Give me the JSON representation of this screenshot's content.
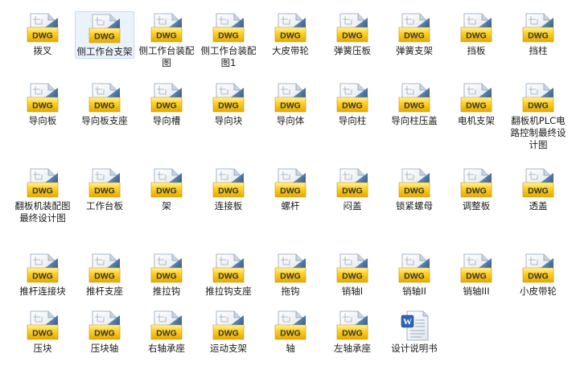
{
  "files": [
    {
      "label": "拨叉",
      "type": "dwg",
      "icon": "dwg-file-icon"
    },
    {
      "label": "侧工作台支架",
      "type": "dwg",
      "icon": "dwg-file-icon",
      "selected": true
    },
    {
      "label": "侧工作台装配图",
      "type": "dwg",
      "icon": "dwg-file-icon"
    },
    {
      "label": "侧工作台装配图1",
      "type": "dwg",
      "icon": "dwg-file-icon"
    },
    {
      "label": "大皮带轮",
      "type": "dwg",
      "icon": "dwg-file-icon"
    },
    {
      "label": "弹簧压板",
      "type": "dwg",
      "icon": "dwg-file-icon"
    },
    {
      "label": "弹簧支架",
      "type": "dwg",
      "icon": "dwg-file-icon"
    },
    {
      "label": "挡板",
      "type": "dwg",
      "icon": "dwg-file-icon"
    },
    {
      "label": "挡柱",
      "type": "dwg",
      "icon": "dwg-file-icon"
    },
    {
      "label": "导向板",
      "type": "dwg",
      "icon": "dwg-file-icon"
    },
    {
      "label": "导向板支座",
      "type": "dwg",
      "icon": "dwg-file-icon"
    },
    {
      "label": "导向槽",
      "type": "dwg",
      "icon": "dwg-file-icon"
    },
    {
      "label": "导向块",
      "type": "dwg",
      "icon": "dwg-file-icon"
    },
    {
      "label": "导向体",
      "type": "dwg",
      "icon": "dwg-file-icon"
    },
    {
      "label": "导向柱",
      "type": "dwg",
      "icon": "dwg-file-icon"
    },
    {
      "label": "导向柱压盖",
      "type": "dwg",
      "icon": "dwg-file-icon"
    },
    {
      "label": "电机支架",
      "type": "dwg",
      "icon": "dwg-file-icon"
    },
    {
      "label": "翻板机PLC电路控制最终设计图",
      "type": "dwg",
      "icon": "dwg-file-icon"
    },
    {
      "label": "翻板机装配图最终设计图",
      "type": "dwg",
      "icon": "dwg-file-icon"
    },
    {
      "label": "工作台板",
      "type": "dwg",
      "icon": "dwg-file-icon"
    },
    {
      "label": "架",
      "type": "dwg",
      "icon": "dwg-file-icon"
    },
    {
      "label": "连接板",
      "type": "dwg",
      "icon": "dwg-file-icon"
    },
    {
      "label": "螺杆",
      "type": "dwg",
      "icon": "dwg-file-icon"
    },
    {
      "label": "闷盖",
      "type": "dwg",
      "icon": "dwg-file-icon"
    },
    {
      "label": "锁紧螺母",
      "type": "dwg",
      "icon": "dwg-file-icon"
    },
    {
      "label": "调整板",
      "type": "dwg",
      "icon": "dwg-file-icon"
    },
    {
      "label": "透盖",
      "type": "dwg",
      "icon": "dwg-file-icon"
    },
    {
      "label": "推杆连接块",
      "type": "dwg",
      "icon": "dwg-file-icon"
    },
    {
      "label": "推杆支座",
      "type": "dwg",
      "icon": "dwg-file-icon"
    },
    {
      "label": "推拉钩",
      "type": "dwg",
      "icon": "dwg-file-icon"
    },
    {
      "label": "推拉钩支座",
      "type": "dwg",
      "icon": "dwg-file-icon"
    },
    {
      "label": "拖钩",
      "type": "dwg",
      "icon": "dwg-file-icon"
    },
    {
      "label": "销轴I",
      "type": "dwg",
      "icon": "dwg-file-icon"
    },
    {
      "label": "销轴II",
      "type": "dwg",
      "icon": "dwg-file-icon"
    },
    {
      "label": "销轴III",
      "type": "dwg",
      "icon": "dwg-file-icon"
    },
    {
      "label": "小皮带轮",
      "type": "dwg",
      "icon": "dwg-file-icon"
    },
    {
      "label": "压块",
      "type": "dwg",
      "icon": "dwg-file-icon"
    },
    {
      "label": "压块轴",
      "type": "dwg",
      "icon": "dwg-file-icon"
    },
    {
      "label": "右轴承座",
      "type": "dwg",
      "icon": "dwg-file-icon"
    },
    {
      "label": "运动支架",
      "type": "dwg",
      "icon": "dwg-file-icon"
    },
    {
      "label": "轴",
      "type": "dwg",
      "icon": "dwg-file-icon"
    },
    {
      "label": "左轴承座",
      "type": "dwg",
      "icon": "dwg-file-icon"
    },
    {
      "label": "设计说明书",
      "type": "doc",
      "icon": "word-document-icon"
    }
  ],
  "dwg_badge": "DWG",
  "colors": {
    "dwg_yellow": "#f7c600",
    "dwg_blue": "#2c5a93",
    "selection_bg": "#eaf3fc"
  }
}
